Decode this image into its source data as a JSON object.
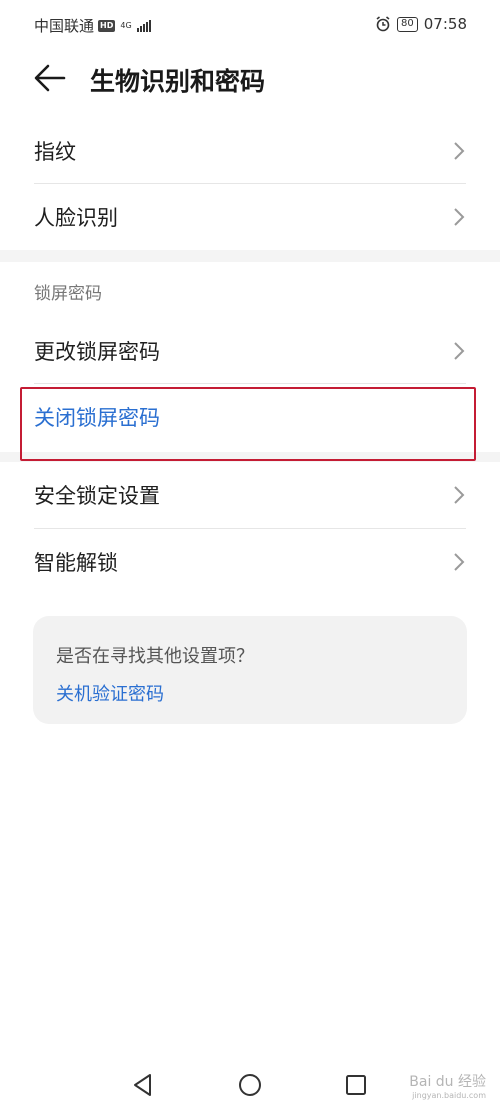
{
  "status_bar": {
    "carrier": "中国联通",
    "hd": "HD",
    "network": "4G",
    "battery": "80",
    "time": "07:58"
  },
  "header": {
    "title": "生物识别和密码"
  },
  "biometrics": [
    {
      "label": "指纹"
    },
    {
      "label": "人脸识别"
    }
  ],
  "lock_section": {
    "title": "锁屏密码",
    "change_label": "更改锁屏密码",
    "disable_label": "关闭锁屏密码"
  },
  "security": [
    {
      "label": "安全锁定设置"
    },
    {
      "label": "智能解锁"
    }
  ],
  "suggestion_card": {
    "question": "是否在寻找其他设置项？",
    "link": "关机验证密码"
  },
  "watermark": {
    "text": "Bai du 经验",
    "sub": "jingyan.baidu.com"
  },
  "colors": {
    "accent": "#2a6fd1",
    "highlight_border": "#c41c34"
  }
}
